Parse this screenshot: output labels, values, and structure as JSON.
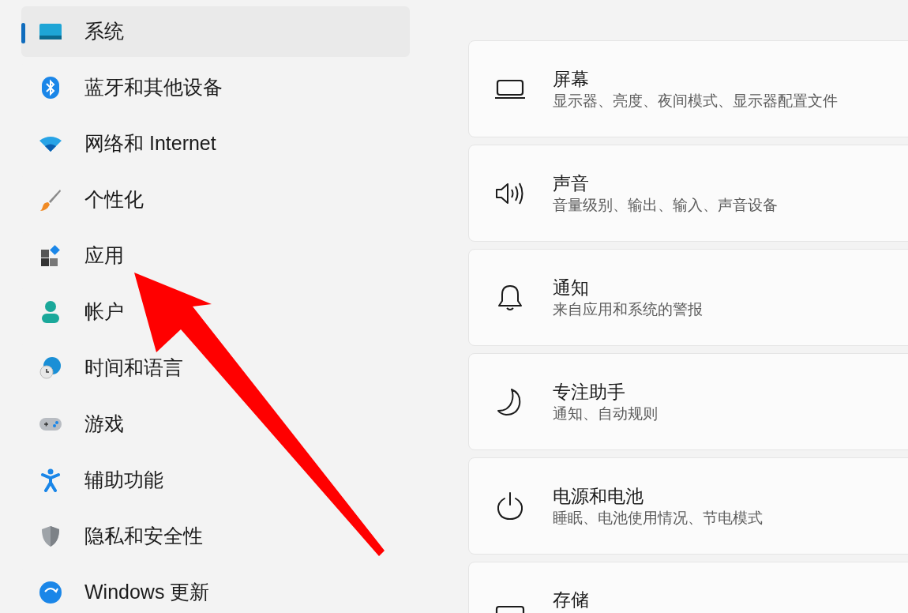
{
  "sidebar": {
    "items": [
      {
        "label": "系统",
        "selected": true
      },
      {
        "label": "蓝牙和其他设备",
        "selected": false
      },
      {
        "label": "网络和 Internet",
        "selected": false
      },
      {
        "label": "个性化",
        "selected": false
      },
      {
        "label": "应用",
        "selected": false
      },
      {
        "label": "帐户",
        "selected": false
      },
      {
        "label": "时间和语言",
        "selected": false
      },
      {
        "label": "游戏",
        "selected": false
      },
      {
        "label": "辅助功能",
        "selected": false
      },
      {
        "label": "隐私和安全性",
        "selected": false
      },
      {
        "label": "Windows 更新",
        "selected": false
      }
    ]
  },
  "settings": [
    {
      "title": "屏幕",
      "subtitle": "显示器、亮度、夜间模式、显示器配置文件"
    },
    {
      "title": "声音",
      "subtitle": "音量级别、输出、输入、声音设备"
    },
    {
      "title": "通知",
      "subtitle": "来自应用和系统的警报"
    },
    {
      "title": "专注助手",
      "subtitle": "通知、自动规则"
    },
    {
      "title": "电源和电池",
      "subtitle": "睡眠、电池使用情况、节电模式"
    },
    {
      "title": "存储"
    }
  ],
  "annotation": {
    "kind": "arrow"
  }
}
